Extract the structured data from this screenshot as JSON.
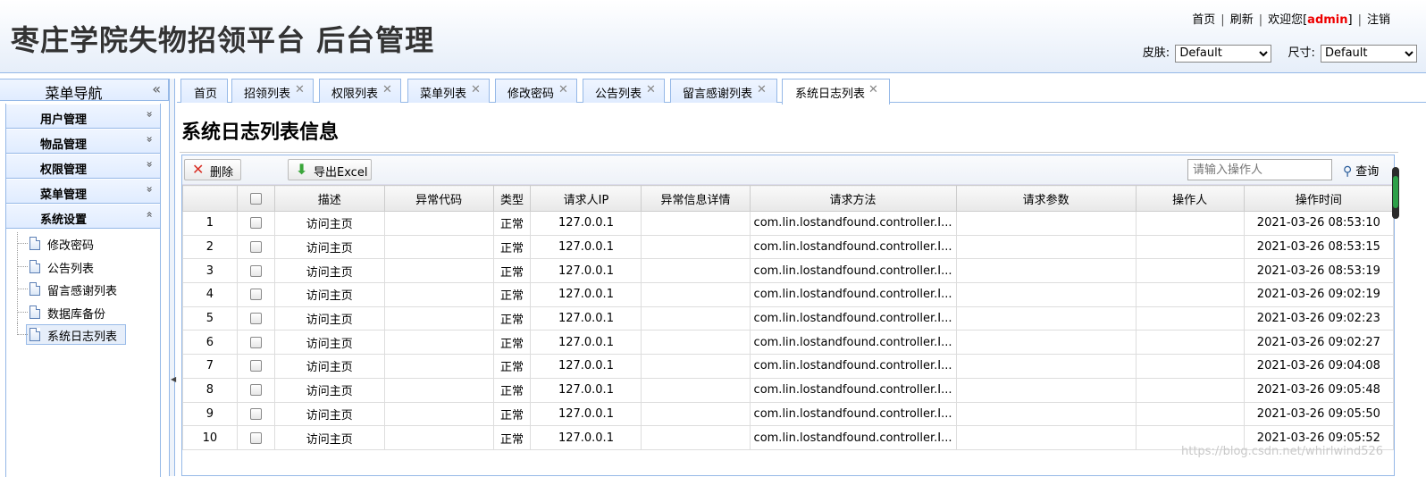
{
  "header": {
    "title": "枣庄学院失物招领平台 后台管理",
    "links": {
      "home": "首页",
      "refresh": "刷新",
      "welcome_prefix": "欢迎您[",
      "user": "admin",
      "welcome_suffix": "]",
      "logout": "注销"
    },
    "skin_label": "皮肤:",
    "skin_value": "Default",
    "size_label": "尺寸:",
    "size_value": "Default"
  },
  "nav": {
    "title": "菜单导航",
    "collapse_glyph": "«",
    "sections": [
      {
        "label": "用户管理",
        "arrow": "»"
      },
      {
        "label": "物品管理",
        "arrow": "»"
      },
      {
        "label": "权限管理",
        "arrow": "»"
      },
      {
        "label": "菜单管理",
        "arrow": "»"
      },
      {
        "label": "系统设置",
        "arrow": "«"
      }
    ],
    "tree_items": [
      "修改密码",
      "公告列表",
      "留言感谢列表",
      "数据库备份",
      "系统日志列表"
    ]
  },
  "tabs": [
    {
      "label": "首页",
      "close": ""
    },
    {
      "label": "招领列表",
      "close": "✕"
    },
    {
      "label": "权限列表",
      "close": "✕"
    },
    {
      "label": "菜单列表",
      "close": "✕"
    },
    {
      "label": "修改密码",
      "close": "✕"
    },
    {
      "label": "公告列表",
      "close": "✕"
    },
    {
      "label": "留言感谢列表",
      "close": "✕"
    },
    {
      "label": "系统日志列表",
      "close": "✕"
    }
  ],
  "content": {
    "page_title": "系统日志列表信息",
    "toolbar": {
      "delete_label": "删除",
      "export_label": "导出Excel",
      "search_placeholder": "请输入操作人",
      "search_label": "查询"
    },
    "columns": [
      "",
      "",
      "描述",
      "异常代码",
      "类型",
      "请求人IP",
      "异常信息详情",
      "请求方法",
      "请求参数",
      "操作人",
      "操作时间"
    ],
    "rows": [
      [
        "1",
        "访问主页",
        "",
        "正常",
        "127.0.0.1",
        "",
        "com.lin.lostandfound.controller.I...",
        "",
        "",
        "2021-03-26 08:53:10"
      ],
      [
        "2",
        "访问主页",
        "",
        "正常",
        "127.0.0.1",
        "",
        "com.lin.lostandfound.controller.I...",
        "",
        "",
        "2021-03-26 08:53:15"
      ],
      [
        "3",
        "访问主页",
        "",
        "正常",
        "127.0.0.1",
        "",
        "com.lin.lostandfound.controller.I...",
        "",
        "",
        "2021-03-26 08:53:19"
      ],
      [
        "4",
        "访问主页",
        "",
        "正常",
        "127.0.0.1",
        "",
        "com.lin.lostandfound.controller.I...",
        "",
        "",
        "2021-03-26 09:02:19"
      ],
      [
        "5",
        "访问主页",
        "",
        "正常",
        "127.0.0.1",
        "",
        "com.lin.lostandfound.controller.I...",
        "",
        "",
        "2021-03-26 09:02:23"
      ],
      [
        "6",
        "访问主页",
        "",
        "正常",
        "127.0.0.1",
        "",
        "com.lin.lostandfound.controller.I...",
        "",
        "",
        "2021-03-26 09:02:27"
      ],
      [
        "7",
        "访问主页",
        "",
        "正常",
        "127.0.0.1",
        "",
        "com.lin.lostandfound.controller.I...",
        "",
        "",
        "2021-03-26 09:04:08"
      ],
      [
        "8",
        "访问主页",
        "",
        "正常",
        "127.0.0.1",
        "",
        "com.lin.lostandfound.controller.I...",
        "",
        "",
        "2021-03-26 09:05:48"
      ],
      [
        "9",
        "访问主页",
        "",
        "正常",
        "127.0.0.1",
        "",
        "com.lin.lostandfound.controller.I...",
        "",
        "",
        "2021-03-26 09:05:50"
      ],
      [
        "10",
        "访问主页",
        "",
        "正常",
        "127.0.0.1",
        "",
        "com.lin.lostandfound.controller.I...",
        "",
        "",
        "2021-03-26 09:05:52"
      ]
    ]
  },
  "watermark": "https://blog.csdn.net/whirlwind526"
}
